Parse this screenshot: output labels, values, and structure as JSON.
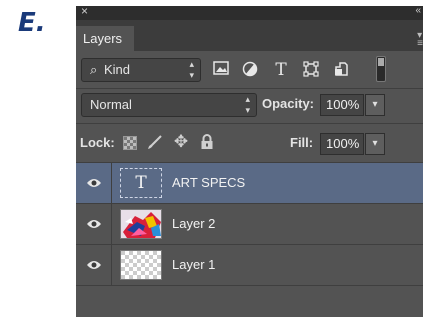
{
  "step_letter": "E.",
  "panel": {
    "close_glyph": "×",
    "tab_label": "Layers"
  },
  "filter": {
    "kind_label": "Kind",
    "icons": [
      "pixel-layer-filter-icon",
      "adjustment-layer-filter-icon",
      "type-layer-filter-icon",
      "shape-layer-filter-icon",
      "smart-object-filter-icon",
      "filter-toggle-icon"
    ]
  },
  "blend": {
    "mode": "Normal",
    "opacity_label": "Opacity:",
    "opacity_value": "100%"
  },
  "lock": {
    "label": "Lock:",
    "fill_label": "Fill:",
    "fill_value": "100%",
    "icons": [
      "lock-transparent-pixels-icon",
      "lock-image-pixels-icon",
      "lock-position-icon",
      "lock-all-icon"
    ]
  },
  "layers": [
    {
      "name": "ART SPECS",
      "type": "text",
      "selected": true,
      "visible": true
    },
    {
      "name": "Layer 2",
      "type": "image",
      "selected": false,
      "visible": true
    },
    {
      "name": "Layer 1",
      "type": "transparent",
      "selected": false,
      "visible": true
    }
  ],
  "colors": {
    "panel_bg": "#535353",
    "selected_row": "#5a6a86",
    "step_letter": "#1a3a7a"
  }
}
